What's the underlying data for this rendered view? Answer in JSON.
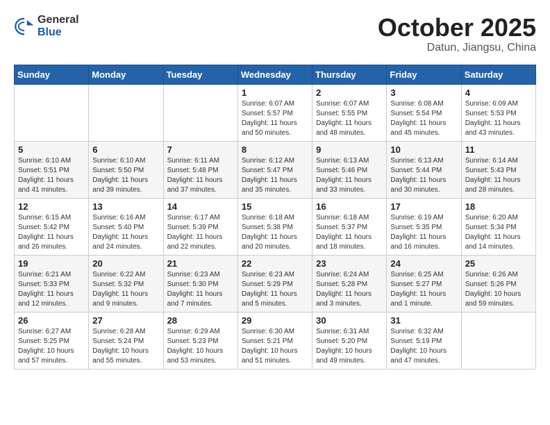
{
  "logo": {
    "general": "General",
    "blue": "Blue"
  },
  "header": {
    "month": "October 2025",
    "location": "Datun, Jiangsu, China"
  },
  "weekdays": [
    "Sunday",
    "Monday",
    "Tuesday",
    "Wednesday",
    "Thursday",
    "Friday",
    "Saturday"
  ],
  "weeks": [
    [
      {
        "day": "",
        "info": ""
      },
      {
        "day": "",
        "info": ""
      },
      {
        "day": "",
        "info": ""
      },
      {
        "day": "1",
        "info": "Sunrise: 6:07 AM\nSunset: 5:57 PM\nDaylight: 11 hours\nand 50 minutes."
      },
      {
        "day": "2",
        "info": "Sunrise: 6:07 AM\nSunset: 5:55 PM\nDaylight: 11 hours\nand 48 minutes."
      },
      {
        "day": "3",
        "info": "Sunrise: 6:08 AM\nSunset: 5:54 PM\nDaylight: 11 hours\nand 45 minutes."
      },
      {
        "day": "4",
        "info": "Sunrise: 6:09 AM\nSunset: 5:53 PM\nDaylight: 11 hours\nand 43 minutes."
      }
    ],
    [
      {
        "day": "5",
        "info": "Sunrise: 6:10 AM\nSunset: 5:51 PM\nDaylight: 11 hours\nand 41 minutes."
      },
      {
        "day": "6",
        "info": "Sunrise: 6:10 AM\nSunset: 5:50 PM\nDaylight: 11 hours\nand 39 minutes."
      },
      {
        "day": "7",
        "info": "Sunrise: 6:11 AM\nSunset: 5:48 PM\nDaylight: 11 hours\nand 37 minutes."
      },
      {
        "day": "8",
        "info": "Sunrise: 6:12 AM\nSunset: 5:47 PM\nDaylight: 11 hours\nand 35 minutes."
      },
      {
        "day": "9",
        "info": "Sunrise: 6:13 AM\nSunset: 5:46 PM\nDaylight: 11 hours\nand 33 minutes."
      },
      {
        "day": "10",
        "info": "Sunrise: 6:13 AM\nSunset: 5:44 PM\nDaylight: 11 hours\nand 30 minutes."
      },
      {
        "day": "11",
        "info": "Sunrise: 6:14 AM\nSunset: 5:43 PM\nDaylight: 11 hours\nand 28 minutes."
      }
    ],
    [
      {
        "day": "12",
        "info": "Sunrise: 6:15 AM\nSunset: 5:42 PM\nDaylight: 11 hours\nand 26 minutes."
      },
      {
        "day": "13",
        "info": "Sunrise: 6:16 AM\nSunset: 5:40 PM\nDaylight: 11 hours\nand 24 minutes."
      },
      {
        "day": "14",
        "info": "Sunrise: 6:17 AM\nSunset: 5:39 PM\nDaylight: 11 hours\nand 22 minutes."
      },
      {
        "day": "15",
        "info": "Sunrise: 6:18 AM\nSunset: 5:38 PM\nDaylight: 11 hours\nand 20 minutes."
      },
      {
        "day": "16",
        "info": "Sunrise: 6:18 AM\nSunset: 5:37 PM\nDaylight: 11 hours\nand 18 minutes."
      },
      {
        "day": "17",
        "info": "Sunrise: 6:19 AM\nSunset: 5:35 PM\nDaylight: 11 hours\nand 16 minutes."
      },
      {
        "day": "18",
        "info": "Sunrise: 6:20 AM\nSunset: 5:34 PM\nDaylight: 11 hours\nand 14 minutes."
      }
    ],
    [
      {
        "day": "19",
        "info": "Sunrise: 6:21 AM\nSunset: 5:33 PM\nDaylight: 11 hours\nand 12 minutes."
      },
      {
        "day": "20",
        "info": "Sunrise: 6:22 AM\nSunset: 5:32 PM\nDaylight: 11 hours\nand 9 minutes."
      },
      {
        "day": "21",
        "info": "Sunrise: 6:23 AM\nSunset: 5:30 PM\nDaylight: 11 hours\nand 7 minutes."
      },
      {
        "day": "22",
        "info": "Sunrise: 6:23 AM\nSunset: 5:29 PM\nDaylight: 11 hours\nand 5 minutes."
      },
      {
        "day": "23",
        "info": "Sunrise: 6:24 AM\nSunset: 5:28 PM\nDaylight: 11 hours\nand 3 minutes."
      },
      {
        "day": "24",
        "info": "Sunrise: 6:25 AM\nSunset: 5:27 PM\nDaylight: 11 hours\nand 1 minute."
      },
      {
        "day": "25",
        "info": "Sunrise: 6:26 AM\nSunset: 5:26 PM\nDaylight: 10 hours\nand 59 minutes."
      }
    ],
    [
      {
        "day": "26",
        "info": "Sunrise: 6:27 AM\nSunset: 5:25 PM\nDaylight: 10 hours\nand 57 minutes."
      },
      {
        "day": "27",
        "info": "Sunrise: 6:28 AM\nSunset: 5:24 PM\nDaylight: 10 hours\nand 55 minutes."
      },
      {
        "day": "28",
        "info": "Sunrise: 6:29 AM\nSunset: 5:23 PM\nDaylight: 10 hours\nand 53 minutes."
      },
      {
        "day": "29",
        "info": "Sunrise: 6:30 AM\nSunset: 5:21 PM\nDaylight: 10 hours\nand 51 minutes."
      },
      {
        "day": "30",
        "info": "Sunrise: 6:31 AM\nSunset: 5:20 PM\nDaylight: 10 hours\nand 49 minutes."
      },
      {
        "day": "31",
        "info": "Sunrise: 6:32 AM\nSunset: 5:19 PM\nDaylight: 10 hours\nand 47 minutes."
      },
      {
        "day": "",
        "info": ""
      }
    ]
  ]
}
